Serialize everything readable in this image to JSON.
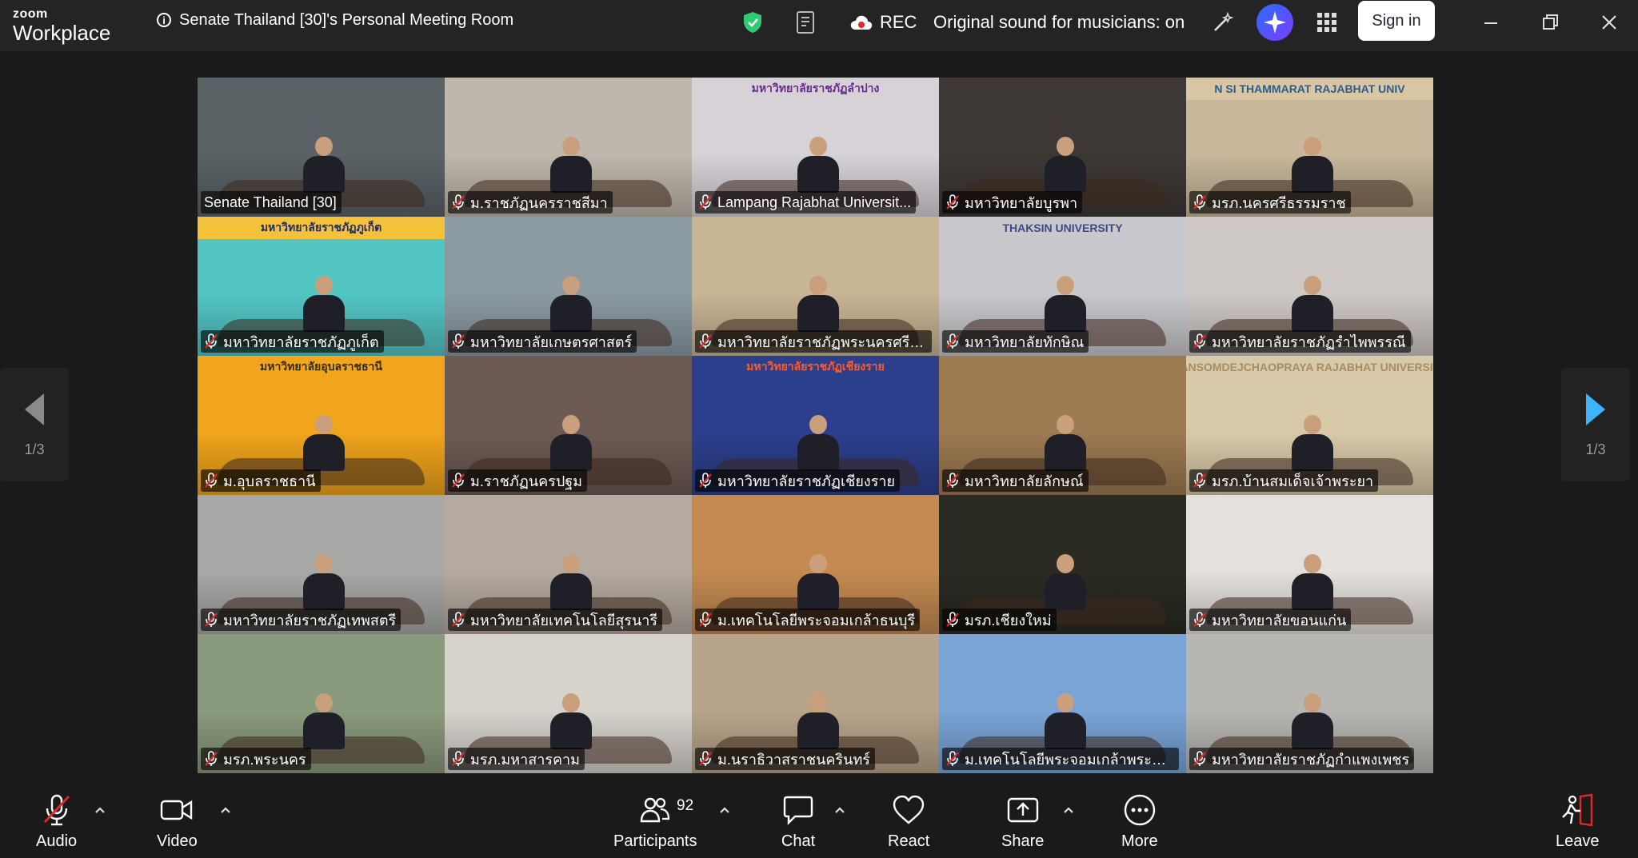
{
  "app": {
    "logo_top": "zoom",
    "logo_bottom": "Workplace",
    "meeting_title": "Senate Thailand [30]'s Personal Meeting Room",
    "rec_label": "REC",
    "original_sound": "Original sound for musicians: on",
    "sign_in": "Sign in"
  },
  "colors": {
    "active_speaker": "#2ed574",
    "security_shield": "#2ecc71",
    "rec_red": "#e02828",
    "pager_arrow_active": "#3db4ff",
    "leave_red": "#e02828"
  },
  "pager": {
    "left_page": "1/3",
    "right_page": "1/3"
  },
  "participants": [
    {
      "name": "Senate Thailand [30]",
      "muted": false,
      "active": true,
      "bg": "#5a6266",
      "banner": "",
      "banner_bg": "",
      "banner_fg": ""
    },
    {
      "name": "ม.ราชภัฏนครราชสีมา",
      "muted": true,
      "active": false,
      "bg": "#bfb7ab",
      "banner": "",
      "banner_bg": "",
      "banner_fg": ""
    },
    {
      "name": "Lampang Rajabhat Universit...",
      "muted": true,
      "active": false,
      "bg": "#d7d2d8",
      "banner": "มหาวิทยาลัยราชภัฏลำปาง",
      "banner_bg": "transparent",
      "banner_fg": "#6a2a8a"
    },
    {
      "name": "มหาวิทยาลัยบูรพา",
      "muted": true,
      "active": false,
      "bg": "#3d3836",
      "banner": "",
      "banner_bg": "",
      "banner_fg": ""
    },
    {
      "name": "มรภ.นครศรีธรรมราช",
      "muted": true,
      "active": false,
      "bg": "#c8b79b",
      "banner": "N SI THAMMARAT RAJABHAT UNIV",
      "banner_bg": "#d9c6a4",
      "banner_fg": "#2a5d8f"
    },
    {
      "name": "มหาวิทยาลัยราชภัฏภูเก็ต",
      "muted": true,
      "active": false,
      "bg": "#53c6c4",
      "banner": "มหาวิทยาลัยราชภัฏภูเก็ต",
      "banner_bg": "#f4c23a",
      "banner_fg": "#1e2a6b"
    },
    {
      "name": "มหาวิทยาลัยเกษตรศาสตร์",
      "muted": true,
      "active": false,
      "bg": "#8c9aa3",
      "banner": "",
      "banner_bg": "",
      "banner_fg": ""
    },
    {
      "name": "มหาวิทยาลัยราชภัฏพระนครศรีอยุ...",
      "muted": true,
      "active": false,
      "bg": "#c8b594",
      "banner": "",
      "banner_bg": "",
      "banner_fg": ""
    },
    {
      "name": "มหาวิทยาลัยทักษิณ",
      "muted": true,
      "active": false,
      "bg": "#c9c8cc",
      "banner": "THAKSIN UNIVERSITY",
      "banner_bg": "transparent",
      "banner_fg": "#3b4b8a"
    },
    {
      "name": "มหาวิทยาลัยราชภัฏรำไพพรรณี",
      "muted": true,
      "active": false,
      "bg": "#cfc9c6",
      "banner": "",
      "banner_bg": "",
      "banner_fg": ""
    },
    {
      "name": "ม.อุบลราชธานี",
      "muted": true,
      "active": false,
      "bg": "#f0a51c",
      "banner": "มหาวิทยาลัยอุบลราชธานี",
      "banner_bg": "transparent",
      "banner_fg": "#3a2a10"
    },
    {
      "name": "ม.ราชภัฏนครปฐม",
      "muted": true,
      "active": false,
      "bg": "#6d5a54",
      "banner": "",
      "banner_bg": "",
      "banner_fg": ""
    },
    {
      "name": "มหาวิทยาลัยราชภัฏเชียงราย",
      "muted": true,
      "active": false,
      "bg": "#2c3f8c",
      "banner": "มหาวิทยาลัยราชภัฏเชียงราย",
      "banner_bg": "transparent",
      "banner_fg": "#ff5a2c"
    },
    {
      "name": "มหาวิทยาลัยลักษณ์",
      "muted": true,
      "active": false,
      "bg": "#9c7a52",
      "banner": "",
      "banner_bg": "",
      "banner_fg": ""
    },
    {
      "name": "มรภ.บ้านสมเด็จเจ้าพระยา",
      "muted": true,
      "active": false,
      "bg": "#d8c9a8",
      "banner": "BANSOMDEJCHAOPRAYA RAJABHAT UNIVERSITY",
      "banner_bg": "transparent",
      "banner_fg": "#a88c62"
    },
    {
      "name": "มหาวิทยาลัยราชภัฏเทพสตรี",
      "muted": true,
      "active": false,
      "bg": "#a8a8a6",
      "banner": "",
      "banner_bg": "",
      "banner_fg": ""
    },
    {
      "name": "มหาวิทยาลัยเทคโนโลยีสุรนารี",
      "muted": true,
      "active": false,
      "bg": "#b4aaa0",
      "banner": "",
      "banner_bg": "",
      "banner_fg": ""
    },
    {
      "name": "ม.เทคโนโลยีพระจอมเกล้าธนบุรี",
      "muted": true,
      "active": false,
      "bg": "#c48a52",
      "banner": "",
      "banner_bg": "",
      "banner_fg": ""
    },
    {
      "name": "มรภ.เชียงใหม่",
      "muted": true,
      "active": false,
      "bg": "#2a2a22",
      "banner": "",
      "banner_bg": "",
      "banner_fg": ""
    },
    {
      "name": "มหาวิทยาลัยขอนแก่น",
      "muted": true,
      "active": false,
      "bg": "#e4e0dc",
      "banner": "",
      "banner_bg": "",
      "banner_fg": ""
    },
    {
      "name": "มรภ.พระนคร",
      "muted": true,
      "active": false,
      "bg": "#8a9a7c",
      "banner": "",
      "banner_bg": "",
      "banner_fg": ""
    },
    {
      "name": "มรภ.มหาสารคาม",
      "muted": true,
      "active": false,
      "bg": "#d6d2cc",
      "banner": "",
      "banner_bg": "",
      "banner_fg": ""
    },
    {
      "name": "ม.นราธิวาสราชนครินทร์",
      "muted": true,
      "active": false,
      "bg": "#b8a48a",
      "banner": "",
      "banner_bg": "",
      "banner_fg": ""
    },
    {
      "name": "ม.เทคโนโลยีพระจอมเกล้าพระนคร...",
      "muted": true,
      "active": false,
      "bg": "#7aa4d6",
      "banner": "",
      "banner_bg": "",
      "banner_fg": ""
    },
    {
      "name": "มหาวิทยาลัยราชภัฏกำแพงเพชร",
      "muted": true,
      "active": false,
      "bg": "#b8b6b2",
      "banner": "",
      "banner_bg": "",
      "banner_fg": ""
    }
  ],
  "toolbar": {
    "audio": "Audio",
    "video": "Video",
    "participants": "Participants",
    "participants_count": "92",
    "chat": "Chat",
    "react": "React",
    "share": "Share",
    "more": "More",
    "leave": "Leave"
  }
}
